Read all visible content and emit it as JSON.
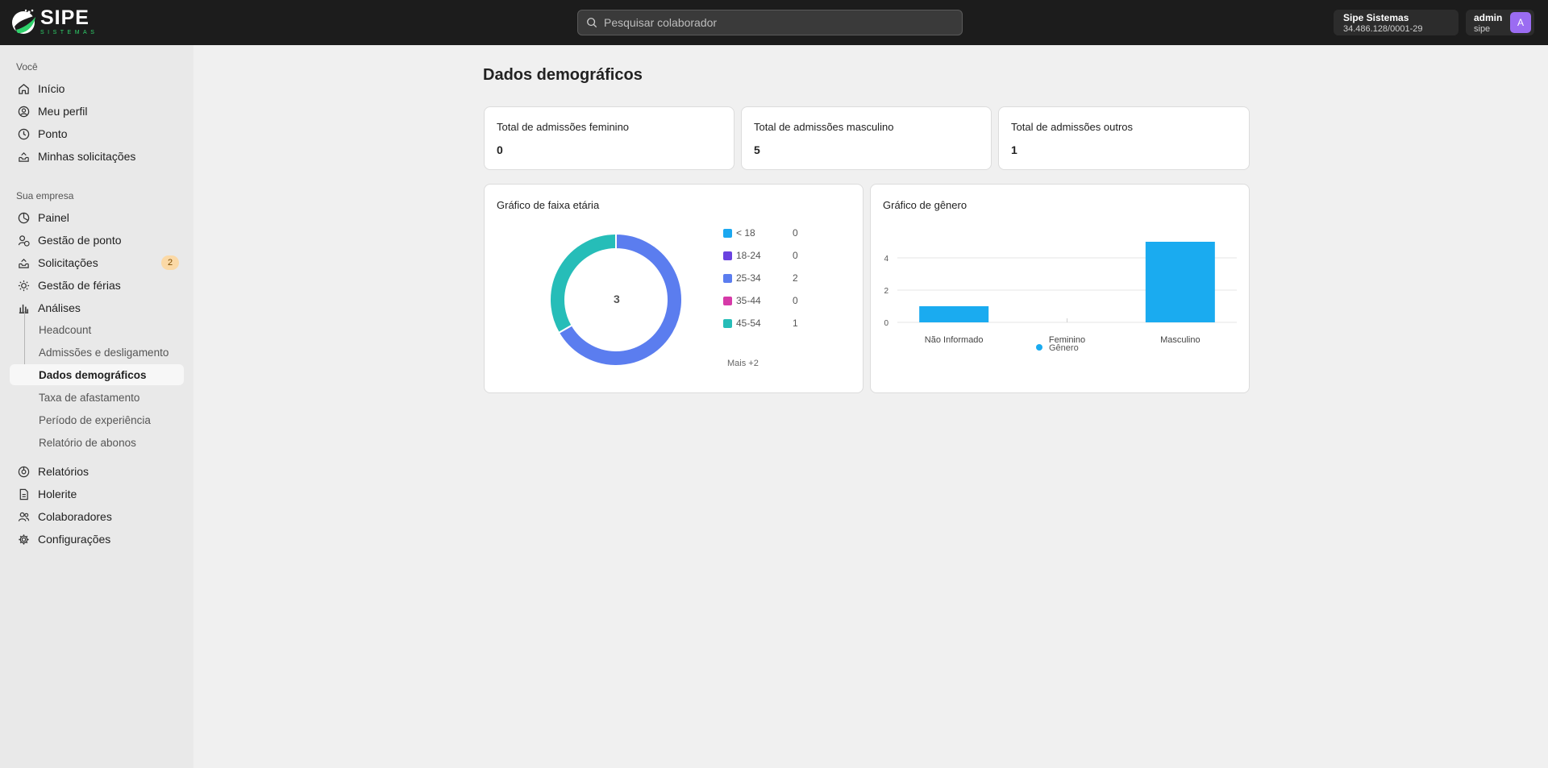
{
  "header": {
    "logo": {
      "brand": "SIPE",
      "sub": "SISTEMAS"
    },
    "search_placeholder": "Pesquisar colaborador",
    "company_name": "Sipe Sistemas",
    "company_cnpj": "34.486.128/0001-29",
    "user_name": "admin",
    "user_role": "sipe",
    "user_initial": "A"
  },
  "sidebar": {
    "section_you": "Você",
    "you_items": [
      {
        "label": "Início",
        "icon": "home-icon"
      },
      {
        "label": "Meu perfil",
        "icon": "user-circle-icon"
      },
      {
        "label": "Ponto",
        "icon": "clock-icon"
      },
      {
        "label": "Minhas solicitações",
        "icon": "inbox-icon"
      }
    ],
    "section_company": "Sua empresa",
    "company_items": [
      {
        "label": "Painel",
        "icon": "dashboard-icon"
      },
      {
        "label": "Gestão de ponto",
        "icon": "clock-user-icon"
      },
      {
        "label": "Solicitações",
        "icon": "inbox-icon",
        "badge": "2"
      },
      {
        "label": "Gestão de férias",
        "icon": "sun-icon"
      },
      {
        "label": "Análises",
        "icon": "bar-chart-icon"
      }
    ],
    "analysis_sub": [
      {
        "label": "Headcount"
      },
      {
        "label": "Admissões e desligamento"
      },
      {
        "label": "Dados demográficos",
        "active": true
      },
      {
        "label": "Taxa de afastamento"
      },
      {
        "label": "Período de experiência"
      },
      {
        "label": "Relatório de abonos"
      }
    ],
    "bottom_items": [
      {
        "label": "Relatórios",
        "icon": "report-icon"
      },
      {
        "label": "Holerite",
        "icon": "file-icon"
      },
      {
        "label": "Colaboradores",
        "icon": "users-icon"
      },
      {
        "label": "Configurações",
        "icon": "gear-icon"
      }
    ]
  },
  "main": {
    "title": "Dados demográficos",
    "stats": [
      {
        "label": "Total de admissões feminino",
        "value": "0"
      },
      {
        "label": "Total de admissões masculino",
        "value": "5"
      },
      {
        "label": "Total de admissões outros",
        "value": "1"
      }
    ],
    "age_chart_title": "Gráfico de faixa etária",
    "age_more": "Mais +2",
    "gender_chart_title": "Gráfico de gênero"
  },
  "chart_data": [
    {
      "type": "pie",
      "title": "Gráfico de faixa etária",
      "center_label": "3",
      "categories": [
        "< 18",
        "18-24",
        "25-34",
        "35-44",
        "45-54"
      ],
      "values": [
        0,
        0,
        2,
        0,
        1
      ],
      "colors": [
        "#1ba8f0",
        "#6a42e0",
        "#5b7def",
        "#d63aa8",
        "#26bdb8"
      ]
    },
    {
      "type": "bar",
      "title": "Gráfico de gênero",
      "categories": [
        "Não Informado",
        "Feminino",
        "Masculino"
      ],
      "series": [
        {
          "name": "Gênero",
          "values": [
            1,
            0,
            5
          ],
          "color": "#1aabf0"
        }
      ],
      "yticks": [
        0,
        2,
        4
      ],
      "ylim": [
        0,
        5
      ],
      "grid": true,
      "legend": "bottom"
    }
  ]
}
